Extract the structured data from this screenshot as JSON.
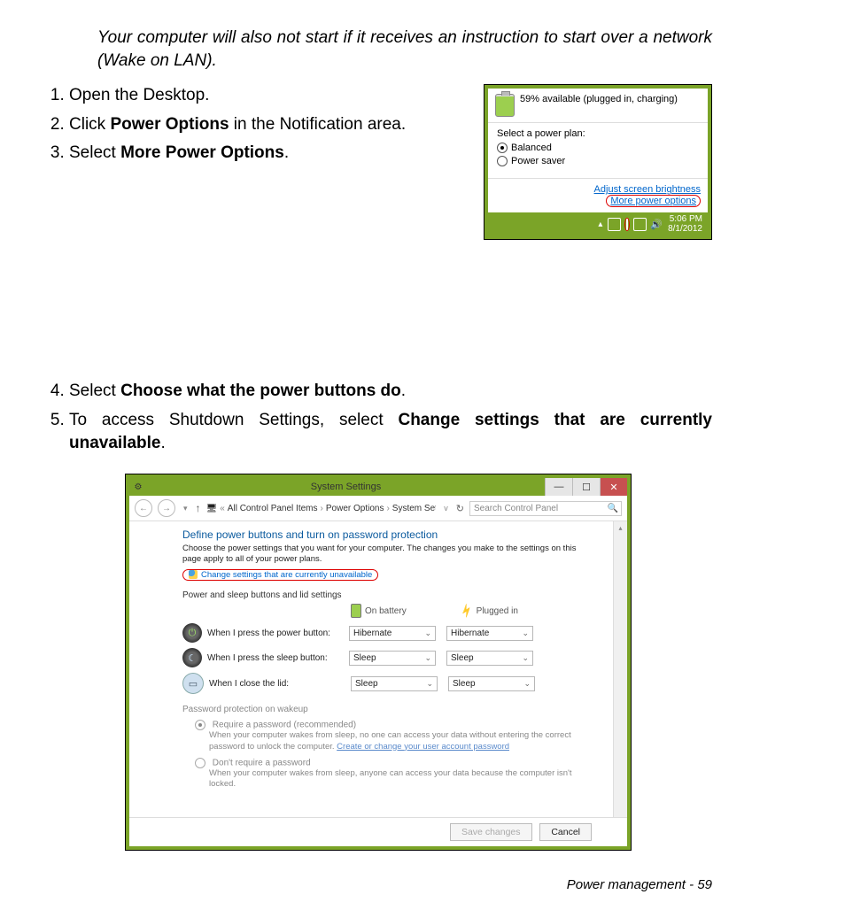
{
  "intro_note": "Your computer will also not start if it receives an instruction to start over a network (Wake on LAN).",
  "steps": {
    "s1": "Open the Desktop.",
    "s2_a": "Click ",
    "s2_b": "Power Options",
    "s2_c": " in the Notification area.",
    "s3_a": "Select ",
    "s3_b": "More Power Options",
    "s3_c": ".",
    "s4_a": "Select ",
    "s4_b": "Choose what the power buttons do",
    "s4_c": ".",
    "s5_a": "To access Shutdown Settings, select ",
    "s5_b": "Change settings that are currently unavailable",
    "s5_c": "."
  },
  "popup": {
    "status": "59% available (plugged in, charging)",
    "select_label": "Select a power plan:",
    "plan_balanced": "Balanced",
    "plan_saver": "Power saver",
    "link_brightness": "Adjust screen brightness",
    "link_more": "More power options",
    "clock_time": "5:06 PM",
    "clock_date": "8/1/2012"
  },
  "syswin": {
    "title": "System Settings",
    "path_seg1": "All Control Panel Items",
    "path_seg2": "Power Options",
    "path_seg3": "System Settings",
    "search_placeholder": "Search Control Panel",
    "heading": "Define power buttons and turn on password protection",
    "subtext": "Choose the power settings that you want for your computer. The changes you make to the settings on this page apply to all of your power plans.",
    "change_link": "Change settings that are currently unavailable",
    "group1": "Power and sleep buttons and lid settings",
    "col_battery": "On battery",
    "col_plugged": "Plugged in",
    "row_power": "When I press the power button:",
    "row_sleep": "When I press the sleep button:",
    "row_lid": "When I close the lid:",
    "val_hibernate": "Hibernate",
    "val_sleep": "Sleep",
    "group2": "Password protection on wakeup",
    "pwd1_title": "Require a password (recommended)",
    "pwd1_desc_a": "When your computer wakes from sleep, no one can access your data without entering the correct password to unlock the computer. ",
    "pwd1_link": "Create or change your user account password",
    "pwd2_title": "Don't require a password",
    "pwd2_desc": "When your computer wakes from sleep, anyone can access your data because the computer isn't locked.",
    "btn_save": "Save changes",
    "btn_cancel": "Cancel"
  },
  "footer": {
    "label": "Power management -  ",
    "page": "59"
  }
}
